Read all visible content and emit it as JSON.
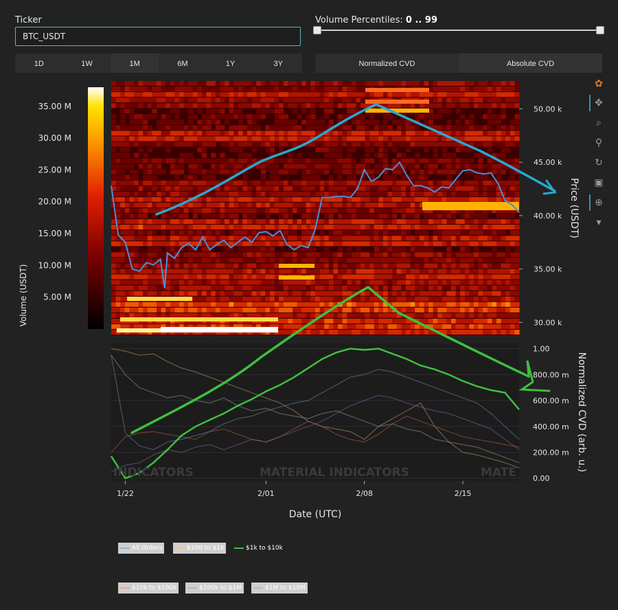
{
  "controls": {
    "ticker_label": "Ticker",
    "ticker_value": "BTC_USDT",
    "volume_percentiles_label": "Volume Percentiles:",
    "volume_percentiles_value": "0 .. 99",
    "volume_percentile_range": [
      0,
      99
    ],
    "time_ranges": [
      "1D",
      "1W",
      "1M",
      "6M",
      "1Y",
      "3Y"
    ],
    "cvd_modes": [
      "Normalized CVD",
      "Absolute CVD"
    ],
    "active_cvd_mode": "Absolute CVD"
  },
  "toolbar": [
    "logo-icon",
    "pan-icon",
    "zoom-icon",
    "zoom-reset-icon",
    "rotate-icon",
    "save-icon",
    "crosshair-icon",
    "hover-icon"
  ],
  "legend": [
    {
      "name": "All Orders",
      "color": "#8fb7d9",
      "active": false
    },
    {
      "name": "$100 to $1k",
      "color": "#f3c596",
      "active": false
    },
    {
      "name": "$1k to $10k",
      "color": "#3fbf3f",
      "active": true
    },
    {
      "name": "$10k to $100k",
      "color": "#f0a890",
      "active": false
    },
    {
      "name": "$100k to $1M",
      "color": "#c6a6e0",
      "active": false
    },
    {
      "name": "$1M to $10M",
      "color": "#bbbbbb",
      "active": false
    }
  ],
  "watermark": "MATERIAL INDICATORS",
  "chart_data": [
    {
      "type": "heatmap",
      "title": "",
      "xlabel": "Date (UTC)",
      "ylabel": "Price (USDT)",
      "colorbar_label": "Volume (USDT)",
      "colorbar_ticks": [
        "5.00 M",
        "10.00 M",
        "15.00 M",
        "20.00 M",
        "25.00 M",
        "30.00 M",
        "35.00 M"
      ],
      "colorbar_values": [
        5,
        10,
        15,
        20,
        25,
        30,
        35
      ],
      "colorbar_range": [
        0,
        38
      ],
      "x_ticks": [
        "1/22",
        "2/01",
        "2/08",
        "2/15"
      ],
      "x_tick_days": [
        1,
        11,
        18,
        25
      ],
      "x_range": [
        0,
        29
      ],
      "y_ticks": [
        "30.00 k",
        "35.00 k",
        "40.00 k",
        "45.00 k",
        "50.00 k"
      ],
      "y_tick_values": [
        30000,
        35000,
        40000,
        45000,
        50000
      ],
      "ylim": [
        28800,
        52600
      ],
      "series": [
        {
          "name": "BTC_USDT",
          "color": "#4a90d9",
          "x": [
            0,
            0.5,
            1,
            1.5,
            2,
            2.5,
            3,
            3.5,
            3.8,
            4,
            4.5,
            5,
            5.5,
            6,
            6.5,
            7,
            7.5,
            8,
            8.5,
            9,
            9.5,
            10,
            10.5,
            11,
            11.5,
            12,
            12.5,
            13,
            13.5,
            14,
            14.5,
            15,
            15.5,
            16,
            16.5,
            17,
            17.5,
            18,
            18.5,
            19,
            19.5,
            20,
            20.5,
            21,
            21.5,
            22,
            22.5,
            23,
            23.5,
            24,
            24.5,
            25,
            25.5,
            26,
            26.5,
            27,
            27.5,
            28,
            28.5,
            29
          ],
          "y": [
            42800,
            38200,
            37500,
            35000,
            34800,
            35600,
            35400,
            35900,
            33200,
            36500,
            36000,
            37000,
            37400,
            36800,
            38000,
            36800,
            37300,
            37700,
            37000,
            37500,
            38000,
            37500,
            38400,
            38500,
            38100,
            38600,
            37300,
            36800,
            37200,
            37000,
            38700,
            41700,
            41700,
            41800,
            41800,
            41700,
            42500,
            44300,
            43200,
            43600,
            44400,
            44300,
            45000,
            43800,
            42800,
            42800,
            42600,
            42200,
            42700,
            42600,
            43400,
            44200,
            44300,
            44000,
            43900,
            44000,
            43000,
            41400,
            41000,
            40300
          ]
        }
      ]
    },
    {
      "type": "line",
      "title": "",
      "xlabel": "Date (UTC)",
      "ylabel": "Normalized CVD (arb. u.)",
      "y_ticks": [
        "0.00",
        "200.00 m",
        "400.00 m",
        "600.00 m",
        "800.00 m",
        "1.00"
      ],
      "y_tick_values": [
        0,
        0.2,
        0.4,
        0.6,
        0.8,
        1.0
      ],
      "ylim": [
        -0.02,
        1.04
      ],
      "x_range": [
        0,
        29
      ],
      "series": [
        {
          "name": "$1k to $10k",
          "color": "#3fbf3f",
          "x": [
            0,
            1,
            2,
            3,
            4,
            5,
            6,
            7,
            8,
            9,
            10,
            11,
            12,
            13,
            14,
            15,
            16,
            17,
            18,
            19,
            20,
            21,
            22,
            23,
            24,
            25,
            26,
            27,
            28,
            29
          ],
          "y": [
            0.17,
            0.0,
            0.04,
            0.12,
            0.22,
            0.33,
            0.4,
            0.45,
            0.5,
            0.56,
            0.61,
            0.67,
            0.72,
            0.78,
            0.85,
            0.92,
            0.97,
            1.0,
            0.99,
            1.0,
            0.96,
            0.92,
            0.87,
            0.84,
            0.8,
            0.75,
            0.71,
            0.68,
            0.66,
            0.53
          ]
        },
        {
          "name": "All Orders",
          "color": "#5e7fa8",
          "x": [
            0,
            1,
            2,
            3,
            4,
            5,
            6,
            7,
            8,
            9,
            10,
            11,
            12,
            13,
            14,
            15,
            16,
            17,
            18,
            19,
            20,
            21,
            22,
            23,
            24,
            25,
            26,
            27,
            28,
            29
          ],
          "y": [
            0.95,
            0.35,
            0.25,
            0.22,
            0.28,
            0.3,
            0.33,
            0.36,
            0.42,
            0.46,
            0.48,
            0.52,
            0.55,
            0.58,
            0.6,
            0.66,
            0.72,
            0.78,
            0.8,
            0.84,
            0.82,
            0.78,
            0.74,
            0.7,
            0.66,
            0.62,
            0.58,
            0.5,
            0.4,
            0.3
          ]
        },
        {
          "name": "$100 to $1k",
          "color": "#b38a5d",
          "x": [
            0,
            1,
            2,
            3,
            4,
            5,
            6,
            7,
            8,
            9,
            10,
            11,
            12,
            13,
            14,
            15,
            16,
            17,
            18,
            19,
            20,
            21,
            22,
            23,
            24,
            25,
            26,
            27,
            28,
            29
          ],
          "y": [
            1.0,
            0.98,
            0.95,
            0.96,
            0.9,
            0.85,
            0.82,
            0.78,
            0.74,
            0.7,
            0.66,
            0.62,
            0.58,
            0.52,
            0.44,
            0.4,
            0.38,
            0.36,
            0.3,
            0.4,
            0.46,
            0.52,
            0.58,
            0.4,
            0.28,
            0.2,
            0.18,
            0.15,
            0.12,
            0.08
          ]
        },
        {
          "name": "$10k to $100k",
          "color": "#a85a4a",
          "x": [
            0,
            1,
            2,
            3,
            4,
            5,
            6,
            7,
            8,
            9,
            10,
            11,
            12,
            13,
            14,
            15,
            16,
            17,
            18,
            19,
            20,
            21,
            22,
            23,
            24,
            25,
            26,
            27,
            28,
            29
          ],
          "y": [
            0.2,
            0.32,
            0.35,
            0.36,
            0.34,
            0.32,
            0.3,
            0.36,
            0.38,
            0.34,
            0.3,
            0.28,
            0.32,
            0.38,
            0.44,
            0.4,
            0.34,
            0.3,
            0.28,
            0.34,
            0.42,
            0.48,
            0.44,
            0.4,
            0.36,
            0.32,
            0.3,
            0.28,
            0.26,
            0.24
          ]
        },
        {
          "name": "$100k to $1M",
          "color": "#7a5fa0",
          "x": [
            0,
            1,
            2,
            3,
            4,
            5,
            6,
            7,
            8,
            9,
            10,
            11,
            12,
            13,
            14,
            15,
            16,
            17,
            18,
            19,
            20,
            21,
            22,
            23,
            24,
            25,
            26,
            27,
            28,
            29
          ],
          "y": [
            0.05,
            0.1,
            0.12,
            0.18,
            0.22,
            0.2,
            0.24,
            0.26,
            0.22,
            0.26,
            0.3,
            0.28,
            0.32,
            0.36,
            0.4,
            0.44,
            0.5,
            0.56,
            0.6,
            0.64,
            0.62,
            0.58,
            0.55,
            0.52,
            0.5,
            0.46,
            0.42,
            0.38,
            0.3,
            0.22
          ]
        },
        {
          "name": "$1M to $10M",
          "color": "#8a8a8a",
          "x": [
            0,
            1,
            2,
            3,
            4,
            5,
            6,
            7,
            8,
            9,
            10,
            11,
            12,
            13,
            14,
            15,
            16,
            17,
            18,
            19,
            20,
            21,
            22,
            23,
            24,
            25,
            26,
            27,
            28,
            29
          ],
          "y": [
            0.95,
            0.8,
            0.7,
            0.66,
            0.62,
            0.64,
            0.6,
            0.58,
            0.62,
            0.56,
            0.52,
            0.54,
            0.5,
            0.48,
            0.46,
            0.5,
            0.52,
            0.48,
            0.44,
            0.4,
            0.42,
            0.38,
            0.36,
            0.3,
            0.28,
            0.26,
            0.24,
            0.2,
            0.16,
            0.12
          ]
        }
      ]
    }
  ]
}
